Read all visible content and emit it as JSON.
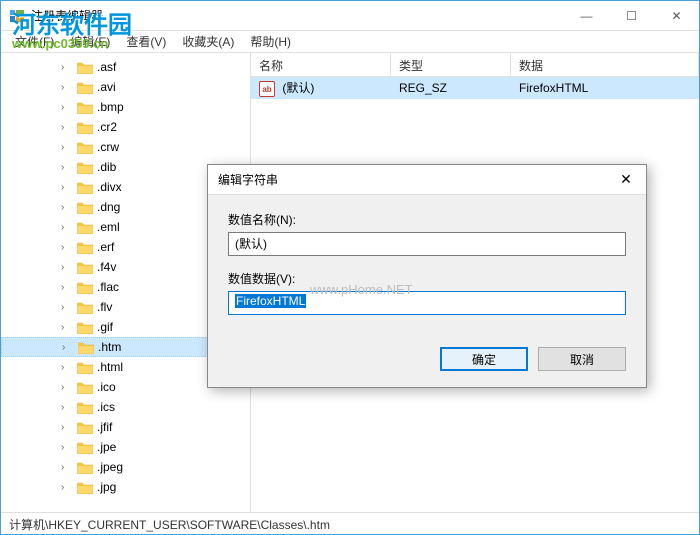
{
  "window": {
    "title": "注册表编辑器",
    "min": "—",
    "max": "☐",
    "close": "✕"
  },
  "menu": {
    "file": "文件(F)",
    "edit": "编辑(E)",
    "view": "查看(V)",
    "fav": "收藏夹(A)",
    "help": "帮助(H)"
  },
  "tree": [
    ".asf",
    ".avi",
    ".bmp",
    ".cr2",
    ".crw",
    ".dib",
    ".divx",
    ".dng",
    ".eml",
    ".erf",
    ".f4v",
    ".flac",
    ".flv",
    ".gif",
    ".htm",
    ".html",
    ".ico",
    ".ics",
    ".jfif",
    ".jpe",
    ".jpeg",
    ".jpg"
  ],
  "tree_selected": ".htm",
  "list": {
    "headers": {
      "name": "名称",
      "type": "类型",
      "data": "数据"
    },
    "row": {
      "icon": "ab",
      "name": "(默认)",
      "type": "REG_SZ",
      "data": "FirefoxHTML"
    }
  },
  "dialog": {
    "title": "编辑字符串",
    "name_label": "数值名称(N):",
    "name_value": "(默认)",
    "data_label": "数值数据(V):",
    "data_value": "FirefoxHTML",
    "ok": "确定",
    "cancel": "取消",
    "close": "✕"
  },
  "statusbar": "计算机\\HKEY_CURRENT_USER\\SOFTWARE\\Classes\\.htm",
  "watermark": {
    "line1": "河东软件园",
    "line2": "www.pc0359.cn",
    "center": "www.pHome.NET"
  }
}
